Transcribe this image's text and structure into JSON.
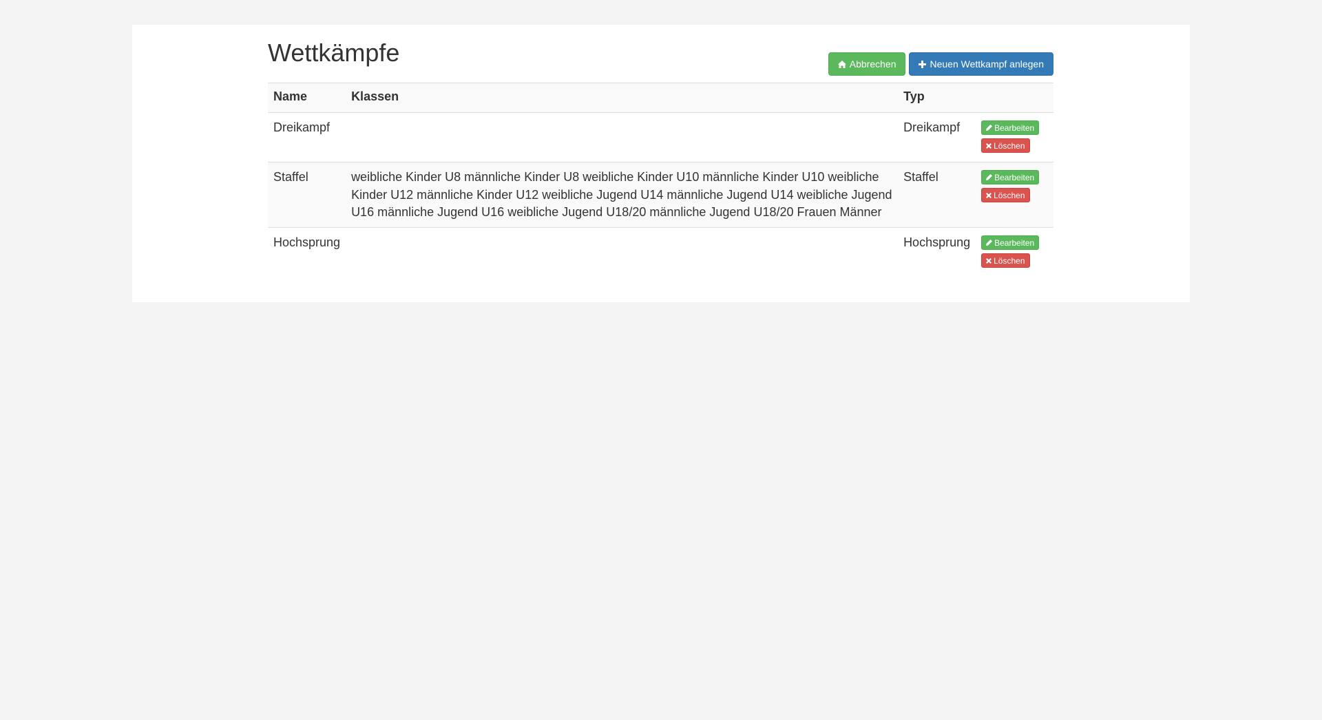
{
  "page": {
    "title": "Wettkämpfe"
  },
  "toolbar": {
    "cancel_label": "Abbrechen",
    "cancel_icon": "home-icon",
    "new_label": "Neuen Wettkampf anlegen",
    "new_icon": "plus-icon"
  },
  "table": {
    "headers": {
      "name": "Name",
      "klassen": "Klassen",
      "typ": "Typ",
      "actions": ""
    },
    "rows": [
      {
        "name": "Dreikampf",
        "klassen": "",
        "typ": "Dreikampf",
        "edit_label": "Bearbeiten",
        "delete_label": "Löschen"
      },
      {
        "name": "Staffel",
        "klassen": "weibliche Kinder U8 männliche Kinder U8 weibliche Kinder U10 männliche Kinder U10 weibliche Kinder U12 männliche Kinder U12 weibliche Jugend U14 männliche Jugend U14 weibliche Jugend U16 männliche Jugend U16 weibliche Jugend U18/20 männliche Jugend U18/20 Frauen Männer",
        "typ": "Staffel",
        "edit_label": "Bearbeiten",
        "delete_label": "Löschen"
      },
      {
        "name": "Hochsprung",
        "klassen": "",
        "typ": "Hochsprung",
        "edit_label": "Bearbeiten",
        "delete_label": "Löschen"
      }
    ]
  },
  "colors": {
    "success": "#5cb85c",
    "primary": "#337ab7",
    "danger": "#d9534f",
    "background": "#f4f4f4"
  }
}
